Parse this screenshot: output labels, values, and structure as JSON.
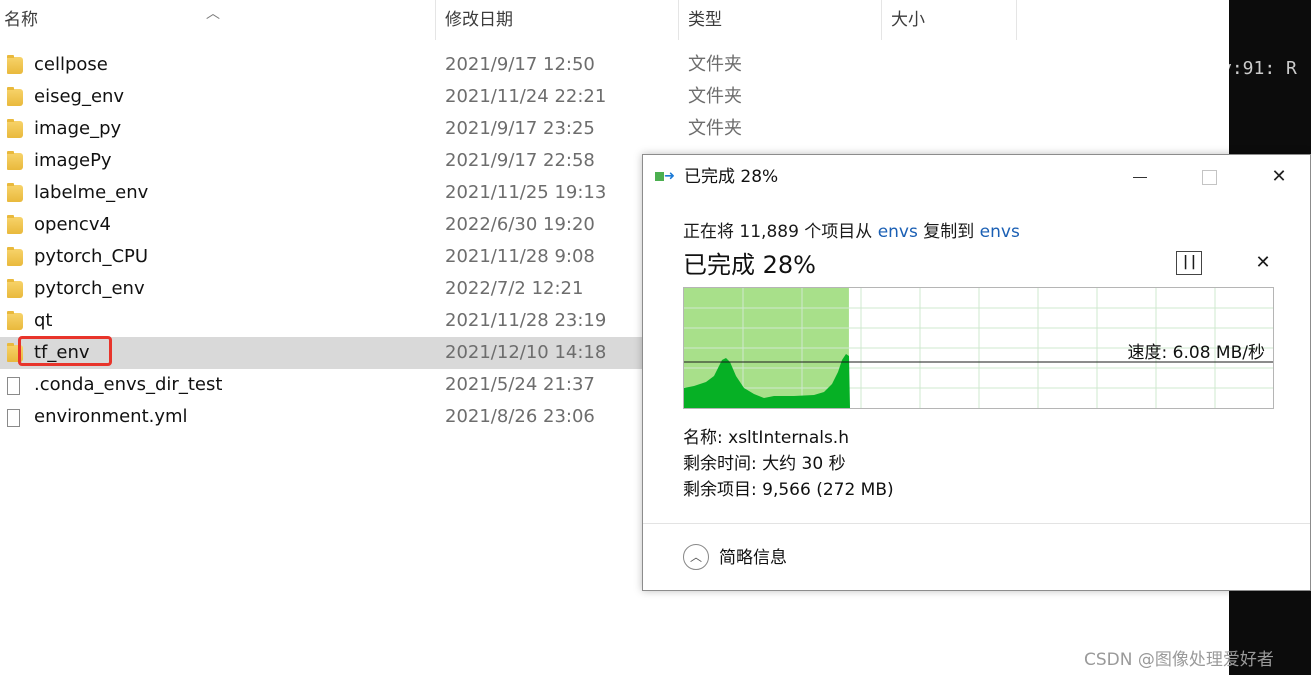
{
  "explorer": {
    "columns": {
      "name": "名称",
      "modified": "修改日期",
      "type": "类型",
      "size": "大小"
    },
    "files": [
      {
        "name": "cellpose",
        "date": "2021/9/17 12:50",
        "type": "文件夹",
        "icon": "folder-icon"
      },
      {
        "name": "eiseg_env",
        "date": "2021/11/24 22:21",
        "type": "文件夹",
        "icon": "folder-icon"
      },
      {
        "name": "image_py",
        "date": "2021/9/17 23:25",
        "type": "文件夹",
        "icon": "folder-icon"
      },
      {
        "name": "imagePy",
        "date": "2021/9/17 22:58",
        "type": "",
        "icon": "folder-icon"
      },
      {
        "name": "labelme_env",
        "date": "2021/11/25 19:13",
        "type": "",
        "icon": "folder-icon"
      },
      {
        "name": "opencv4",
        "date": "2022/6/30 19:20",
        "type": "",
        "icon": "folder-icon"
      },
      {
        "name": "pytorch_CPU",
        "date": "2021/11/28 9:08",
        "type": "",
        "icon": "folder-icon"
      },
      {
        "name": "pytorch_env",
        "date": "2022/7/2 12:21",
        "type": "",
        "icon": "folder-icon"
      },
      {
        "name": "qt",
        "date": "2021/11/28 23:19",
        "type": "",
        "icon": "folder-icon"
      },
      {
        "name": "tf_env",
        "date": "2021/12/10 14:18",
        "type": "",
        "icon": "folder-icon",
        "selected": true
      },
      {
        "name": ".conda_envs_dir_test",
        "date": "2021/5/24 21:37",
        "type": "",
        "icon": "file-icon"
      },
      {
        "name": "environment.yml",
        "date": "2021/8/26 23:06",
        "type": "",
        "icon": "file-icon"
      }
    ]
  },
  "console": {
    "text": "y:91: R"
  },
  "dialog": {
    "title": "已完成 28%",
    "summary": {
      "prefix": "正在将 11,889 个项目从 ",
      "from": "envs",
      "middle": " 复制到 ",
      "to": "envs"
    },
    "status": "已完成 28%",
    "pause_icon": "pause-icon",
    "cancel_icon": "close-icon",
    "speed": "速度: 6.08 MB/秒",
    "progress_percent": 28,
    "details": {
      "name": "名称: xsltInternals.h",
      "time_remaining": "剩余时间: 大约 30 秒",
      "items_remaining": "剩余项目: 9,566 (272 MB)"
    },
    "toggle_label": "简略信息",
    "toggle_icon": "chevron-up-icon",
    "colors": {
      "fill_light": "#a8e08a",
      "fill_dark": "#06b025",
      "link": "#1a5fb4"
    }
  },
  "watermark": "CSDN @图像处理爱好者"
}
